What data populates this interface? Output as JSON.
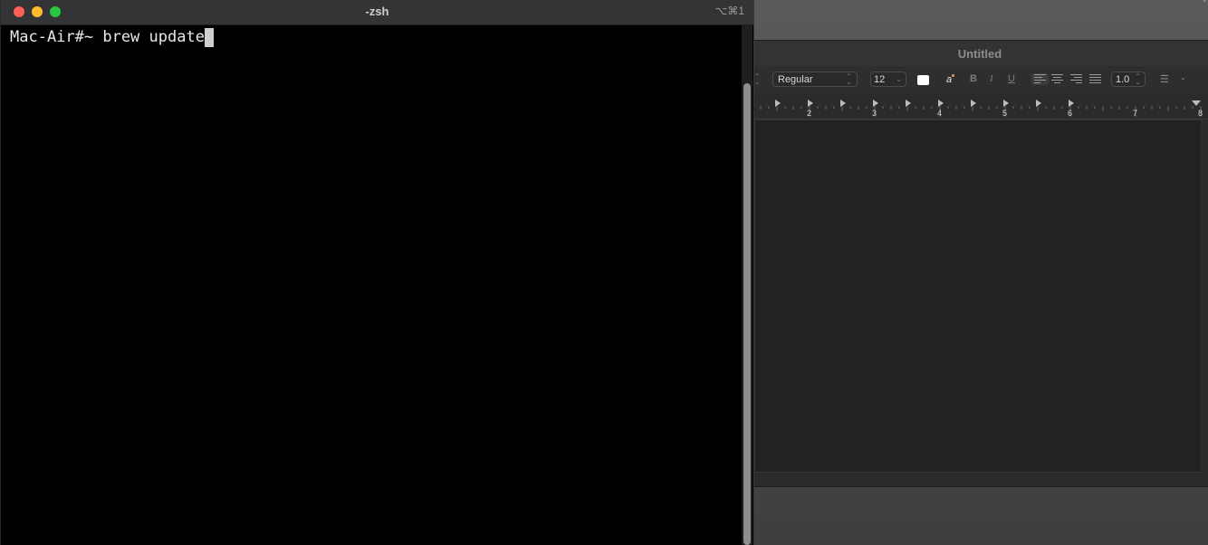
{
  "terminal": {
    "title": "-zsh",
    "shortcut": "⌥⌘1",
    "prompt": "Mac-Air#~ brew update"
  },
  "textedit": {
    "title": "Untitled",
    "style_select": "Regular",
    "font_size": "12",
    "line_spacing": "1.0",
    "bold_label": "B",
    "italic_label": "I",
    "underline_label": "U",
    "highlight_label": "a",
    "text_color": "#ffffff",
    "ruler_numbers": [
      "2",
      "3",
      "4",
      "5",
      "6",
      "7",
      "8"
    ]
  },
  "icons": [
    "close-icon",
    "minimize-icon",
    "zoom-icon",
    "list-bullets-icon",
    "chevron-down-icon"
  ]
}
